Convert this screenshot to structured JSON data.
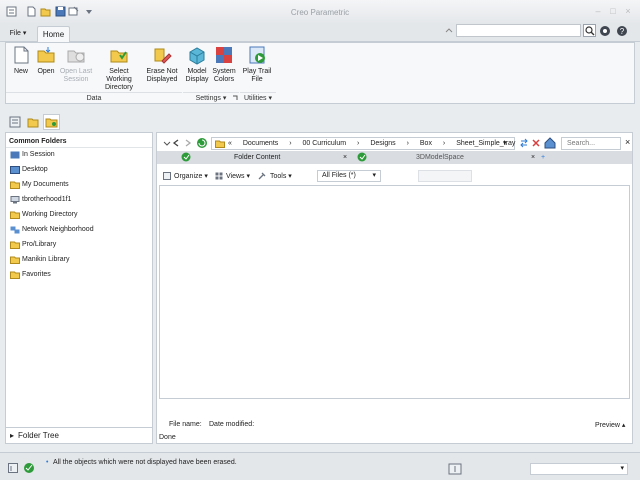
{
  "app": {
    "title": "Creo Parametric"
  },
  "tabs": {
    "file": "File ▾",
    "home": "Home"
  },
  "ribbon": {
    "buttons": [
      {
        "id": "new",
        "label": "New",
        "disabled": false
      },
      {
        "id": "open",
        "label": "Open",
        "disabled": false
      },
      {
        "id": "open-last-session",
        "label": "Open Last Session",
        "disabled": true
      },
      {
        "id": "select-working-directory",
        "label": "Select Working Directory",
        "disabled": false
      },
      {
        "id": "erase-not-displayed",
        "label": "Erase Not Displayed",
        "disabled": false
      },
      {
        "id": "model-display",
        "label": "Model Display",
        "disabled": false
      },
      {
        "id": "system-colors",
        "label": "System Colors",
        "disabled": false
      },
      {
        "id": "play-trail-file",
        "label": "Play Trail File",
        "disabled": false
      }
    ],
    "groups": {
      "data": "Data",
      "settings": "Settings ▾",
      "utilities": "Utilities ▾"
    }
  },
  "left_panel": {
    "header": "Common Folders",
    "items": [
      "In Session",
      "Desktop",
      "My Documents",
      "tbrotherhood1f1",
      "Working Directory",
      "Network Neighborhood",
      "Pro/Library",
      "Manikin Library",
      "Favorites"
    ],
    "folder_tree": "Folder Tree"
  },
  "browser": {
    "breadcrumb": [
      "«",
      "Documents",
      "›",
      "00 Curriculum",
      "›",
      "Designs",
      "›",
      "Box",
      "›",
      "Sheet_Simple_tray"
    ],
    "search_placeholder": "Search...",
    "tabs": [
      "Folder Content",
      "3DModelSpace"
    ],
    "toolbar": {
      "organize": "Organize ▾",
      "views": "Views ▾",
      "tools": "Tools ▾",
      "filter": "All Files (*)"
    },
    "file_name_label": "File name:",
    "date_modified_label": "Date modified:",
    "preview_label": "Preview ▴",
    "status": "Done"
  },
  "statusbar": {
    "message": "All the objects which were not displayed have been erased."
  },
  "colors": {
    "accent": "#2e7bd6",
    "folder": "#f2c94c",
    "panel_border": "#c6ccd3"
  }
}
